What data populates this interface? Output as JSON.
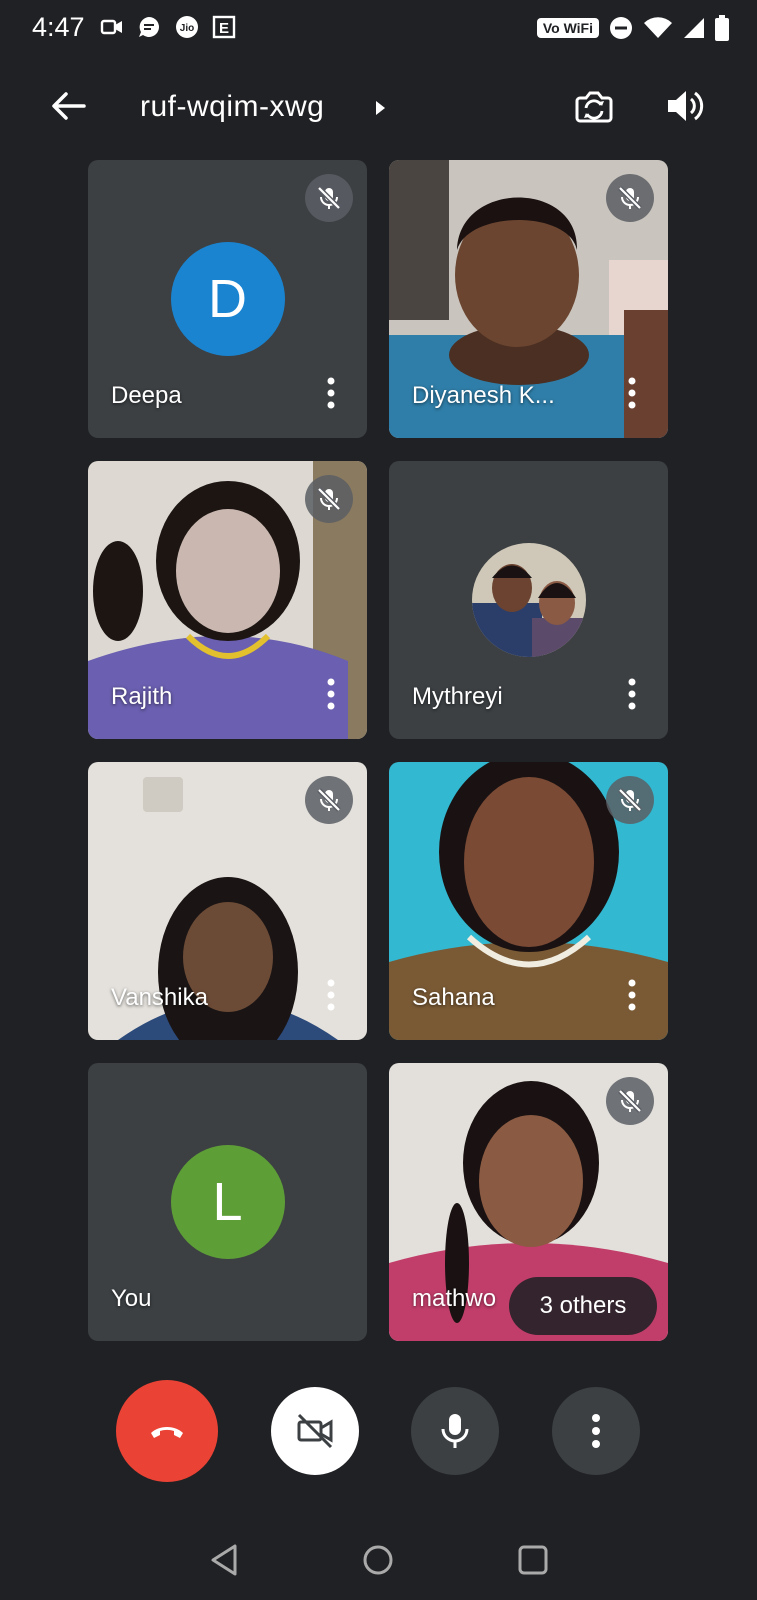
{
  "status_bar": {
    "time": "4:47",
    "network_label": "Vo WiFi",
    "icons": [
      "video-icon",
      "message-icon",
      "jio-icon",
      "e-icon",
      "dnd-icon",
      "wifi-icon",
      "signal-icon",
      "battery-icon"
    ]
  },
  "header": {
    "meeting_code": "ruf-wqim-xwg"
  },
  "participants": [
    {
      "name": "Deepa",
      "type": "avatar",
      "initial": "D",
      "avatar_color": "#1a84d1",
      "muted": true
    },
    {
      "name": "Diyanesh K...",
      "type": "video",
      "muted": true
    },
    {
      "name": "Rajith",
      "type": "video",
      "muted": true
    },
    {
      "name": "Mythreyi",
      "type": "photo",
      "muted": false
    },
    {
      "name": "Vanshika",
      "type": "video",
      "muted": true
    },
    {
      "name": "Sahana",
      "type": "video",
      "muted": true
    },
    {
      "name": "You",
      "type": "avatar",
      "initial": "L",
      "avatar_color": "#5e9e37",
      "muted": false
    },
    {
      "name": "mathwo",
      "type": "video",
      "muted": true
    }
  ],
  "others_pill": "3 others",
  "colors": {
    "background": "#202124",
    "tile": "#3c4043",
    "end_call": "#ea4335"
  }
}
